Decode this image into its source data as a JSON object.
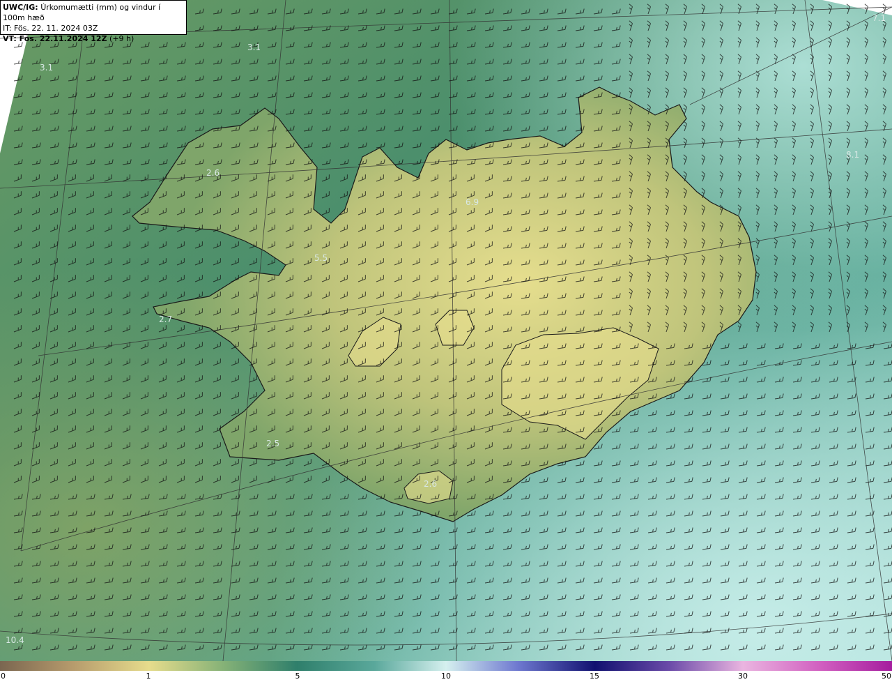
{
  "title": {
    "product": "UWC/IG:",
    "description": "Úrkomumætti (mm) og vindur í 100m hæð",
    "init_time": "IT: Fös. 22. 11. 2024 03Z",
    "valid_prefix": "VT: Fös. 22.11.2024 12Z",
    "valid_suffix": " (+9 h)"
  },
  "colors": {
    "ocean": "#3f8a6f",
    "land_low": "#9fb56f",
    "land_high": "#e3dc8c",
    "coast_line": "#1a1a1a",
    "barb": "#111111",
    "grid": "#333333"
  },
  "colorbar": {
    "ticks": [
      "0",
      "1",
      "5",
      "10",
      "15",
      "30",
      "50"
    ]
  },
  "value_labels": [
    "3.1",
    "3.1",
    "2.6",
    "6.9",
    "5.5",
    "2.7",
    "2.5",
    "2.6",
    "7.1",
    "8.1",
    "10.4"
  ]
}
